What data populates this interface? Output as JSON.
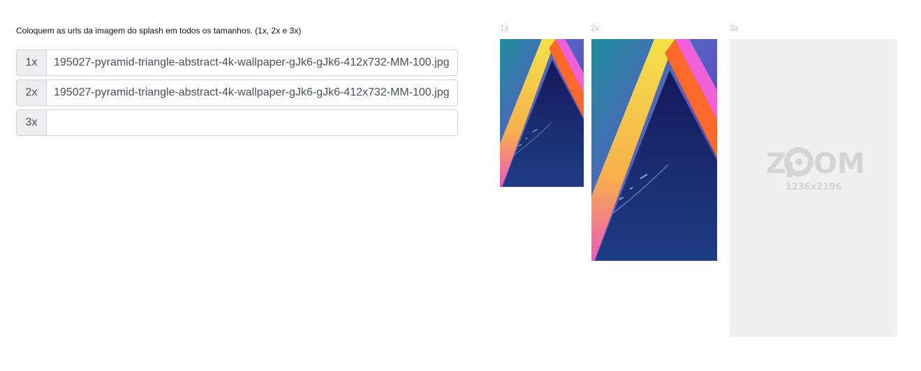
{
  "form": {
    "instructions": "Coloquem as urls da imagem do splash em todos os tamanhos. (1x, 2x e 3x)",
    "rows": [
      {
        "label": "1x",
        "value": "195027-pyramid-triangle-abstract-4k-wallpaper-gJk6-gJk6-412x732-MM-100.jpg"
      },
      {
        "label": "2x",
        "value": "195027-pyramid-triangle-abstract-4k-wallpaper-gJk6-gJk6-412x732-MM-100.jpg"
      },
      {
        "label": "3x",
        "value": ""
      }
    ]
  },
  "previews": {
    "labels": [
      "1x",
      "2x",
      "3x"
    ],
    "placeholder": {
      "logo_text": "ZOOM",
      "size_text": "1236x2196"
    }
  },
  "colors": {
    "addon_bg": "#eceef0",
    "border": "#ced4da",
    "placeholder_bg": "#f0f0f0",
    "label_gray": "#c6c6c6"
  }
}
